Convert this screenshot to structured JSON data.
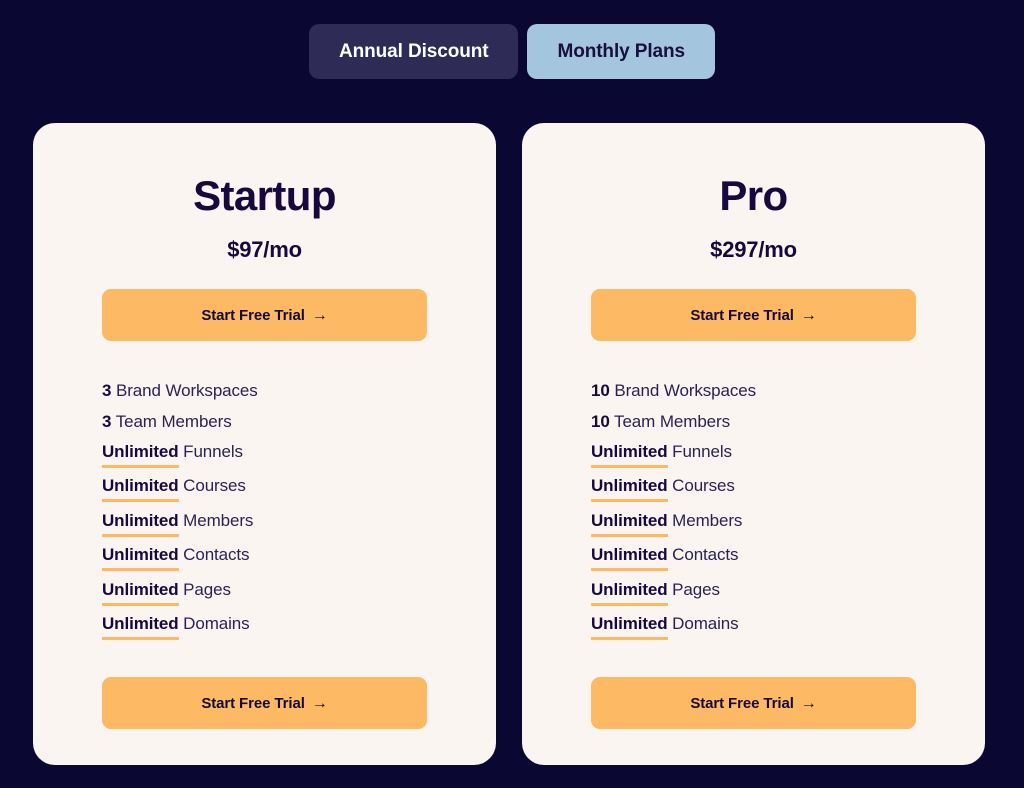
{
  "billing_toggle": {
    "options": [
      {
        "label": "Annual Discount",
        "active": false
      },
      {
        "label": "Monthly Plans",
        "active": true
      }
    ]
  },
  "colors": {
    "background": "#0B0733",
    "card_background": "#FAF5F1",
    "accent_orange": "#FDB963",
    "toggle_active": "#A3C6DE",
    "toggle_inactive": "#2E2B57",
    "text_navy": "#16093D"
  },
  "plans": [
    {
      "name": "Startup",
      "price": "$97/mo",
      "cta_top": "Start Free Trial",
      "cta_bottom": "Start Free Trial",
      "cta_arrow": "→",
      "features": [
        {
          "qty": "3",
          "highlight": false,
          "label": "Brand Workspaces"
        },
        {
          "qty": "3",
          "highlight": false,
          "label": "Team Members"
        },
        {
          "qty": "Unlimited",
          "highlight": true,
          "label": "Funnels"
        },
        {
          "qty": "Unlimited",
          "highlight": true,
          "label": "Courses"
        },
        {
          "qty": "Unlimited",
          "highlight": true,
          "label": "Members"
        },
        {
          "qty": "Unlimited",
          "highlight": true,
          "label": "Contacts"
        },
        {
          "qty": "Unlimited",
          "highlight": true,
          "label": "Pages"
        },
        {
          "qty": "Unlimited",
          "highlight": true,
          "label": "Domains"
        }
      ]
    },
    {
      "name": "Pro",
      "price": "$297/mo",
      "cta_top": "Start Free Trial",
      "cta_bottom": "Start Free Trial",
      "cta_arrow": "→",
      "features": [
        {
          "qty": "10",
          "highlight": false,
          "label": "Brand Workspaces"
        },
        {
          "qty": "10",
          "highlight": false,
          "label": "Team Members"
        },
        {
          "qty": "Unlimited",
          "highlight": true,
          "label": "Funnels"
        },
        {
          "qty": "Unlimited",
          "highlight": true,
          "label": "Courses"
        },
        {
          "qty": "Unlimited",
          "highlight": true,
          "label": "Members"
        },
        {
          "qty": "Unlimited",
          "highlight": true,
          "label": "Contacts"
        },
        {
          "qty": "Unlimited",
          "highlight": true,
          "label": "Pages"
        },
        {
          "qty": "Unlimited",
          "highlight": true,
          "label": "Domains"
        }
      ]
    }
  ]
}
